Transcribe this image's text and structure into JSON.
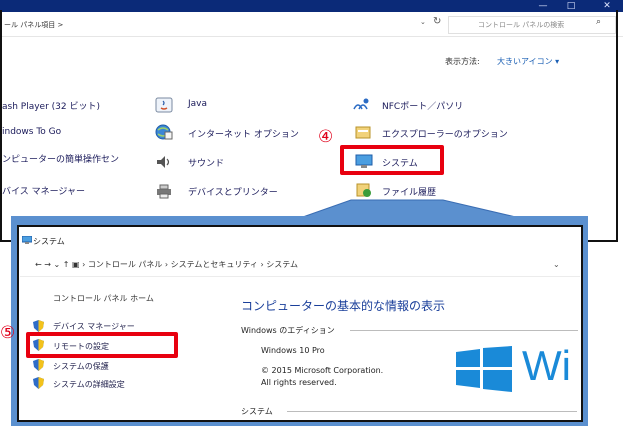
{
  "control_panel": {
    "window_buttons": [
      "—",
      "□",
      "✕"
    ],
    "breadcrumb": "ール パネル項目  >",
    "search_placeholder": "コントロール パネルの検索",
    "view_by_label": "表示方法:",
    "view_by_value": "大きいアイコン ▾",
    "items_col1": [
      "ash Player (32 ビット)",
      "indows To Go",
      "ンピューターの簡単操作セン",
      "バイス マネージャー"
    ],
    "items_col2": [
      "Java",
      "インターネット オプション",
      "サウンド",
      "デバイスとプリンター"
    ],
    "items_col3": [
      "NFCポート／パソリ",
      "エクスプローラーのオプション",
      "システム",
      "ファイル履歴"
    ]
  },
  "steps": {
    "step4": "④",
    "step5": "⑤"
  },
  "system_window": {
    "title": "システム",
    "address_path": "← → ⌄ ↑ ▣ ›  コントロール パネル  ›  システムとセキュリティ  ›  システム",
    "control_panel_home": "コントロール パネル ホーム",
    "side_links": [
      "デバイス マネージャー",
      "リモートの設定",
      "システムの保護",
      "システムの詳細設定"
    ],
    "heading": "コンピューターの基本的な情報の表示",
    "edition_label": "Windows のエディション",
    "version": "Windows 10 Pro",
    "copyright": "© 2015 Microsoft Corporation.",
    "rights": "All rights reserved.",
    "system_label": "システム",
    "windows_brand_text": "Wi"
  },
  "colors": {
    "highlight": "#e8000f",
    "callout": "#5b90cf",
    "titlebar": "#0b2a78",
    "link": "#1a3f9a"
  }
}
